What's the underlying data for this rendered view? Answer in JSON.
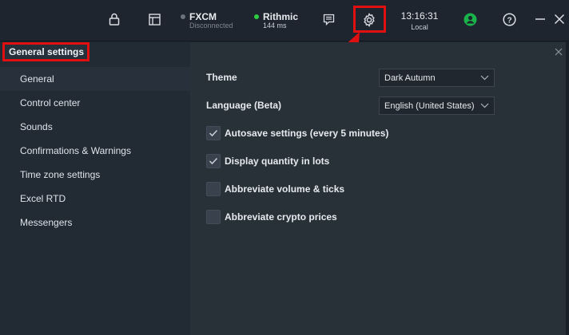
{
  "colors": {
    "highlight": "#e01010",
    "status_disconnected": "#6b737c",
    "status_connected": "#2ecc40",
    "user_green": "#19b34a"
  },
  "topbar": {
    "icons": [
      "lock-icon",
      "layout-icon",
      "chat-icon",
      "gear-icon",
      "user-icon",
      "help-icon",
      "minimize-icon",
      "close-icon"
    ],
    "connections": [
      {
        "name": "FXCM",
        "status": "Disconnected"
      },
      {
        "name": "Rithmic",
        "status": "144 ms"
      }
    ],
    "clock": {
      "time": "13:16:31",
      "zone": "Local"
    }
  },
  "sidebar": {
    "title": "General settings",
    "items": [
      {
        "label": "General"
      },
      {
        "label": "Control center"
      },
      {
        "label": "Sounds"
      },
      {
        "label": "Confirmations & Warnings"
      },
      {
        "label": "Time zone settings"
      },
      {
        "label": "Excel RTD"
      },
      {
        "label": "Messengers"
      }
    ]
  },
  "main": {
    "theme": {
      "label": "Theme",
      "value": "Dark Autumn"
    },
    "language": {
      "label": "Language (Beta)",
      "value": "English (United States)"
    },
    "options": [
      {
        "label": "Autosave settings (every 5 minutes)",
        "checked": true
      },
      {
        "label": "Display quantity in lots",
        "checked": true
      },
      {
        "label": "Abbreviate volume & ticks",
        "checked": false
      },
      {
        "label": "Abbreviate crypto prices",
        "checked": false
      }
    ]
  }
}
